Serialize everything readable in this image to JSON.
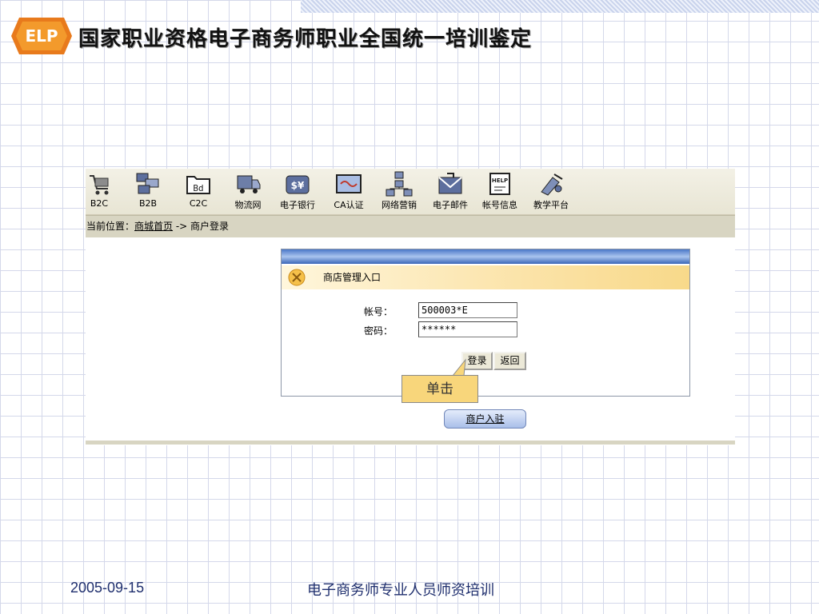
{
  "slide": {
    "title": "国家职业资格电子商务师职业全国统一培训鉴定",
    "footer_date": "2005-09-15",
    "footer_text": "电子商务师专业人员师资培训"
  },
  "toolbar": {
    "items": [
      {
        "label": "B2C",
        "icon": "shopping-cart-icon"
      },
      {
        "label": "B2B",
        "icon": "linked-boxes-icon"
      },
      {
        "label": "C2C",
        "icon": "folder-icon"
      },
      {
        "label": "物流网",
        "icon": "truck-icon"
      },
      {
        "label": "电子银行",
        "icon": "money-bag-icon"
      },
      {
        "label": "CA认证",
        "icon": "certificate-icon"
      },
      {
        "label": "网络营销",
        "icon": "network-icon"
      },
      {
        "label": "电子邮件",
        "icon": "email-icon"
      },
      {
        "label": "帐号信息",
        "icon": "help-notepad-icon"
      },
      {
        "label": "教学平台",
        "icon": "teaching-icon"
      }
    ]
  },
  "breadcrumb": {
    "prefix": "当前位置：",
    "link": "商城首页",
    "separator": " -> ",
    "current": "商户登录"
  },
  "login": {
    "header": "商店管理入口",
    "account_label": "帐号：",
    "account_value": "500003*E",
    "password_label": "密码：",
    "password_value": "******",
    "login_button": "登录",
    "back_button": "返回"
  },
  "callout": {
    "text": "单击"
  },
  "merchant_button": "商户入驻",
  "colors": {
    "callout_fill": "#f8d67b",
    "footer_text": "#1f2f6e",
    "header_gradient": "#fbe3a8"
  }
}
